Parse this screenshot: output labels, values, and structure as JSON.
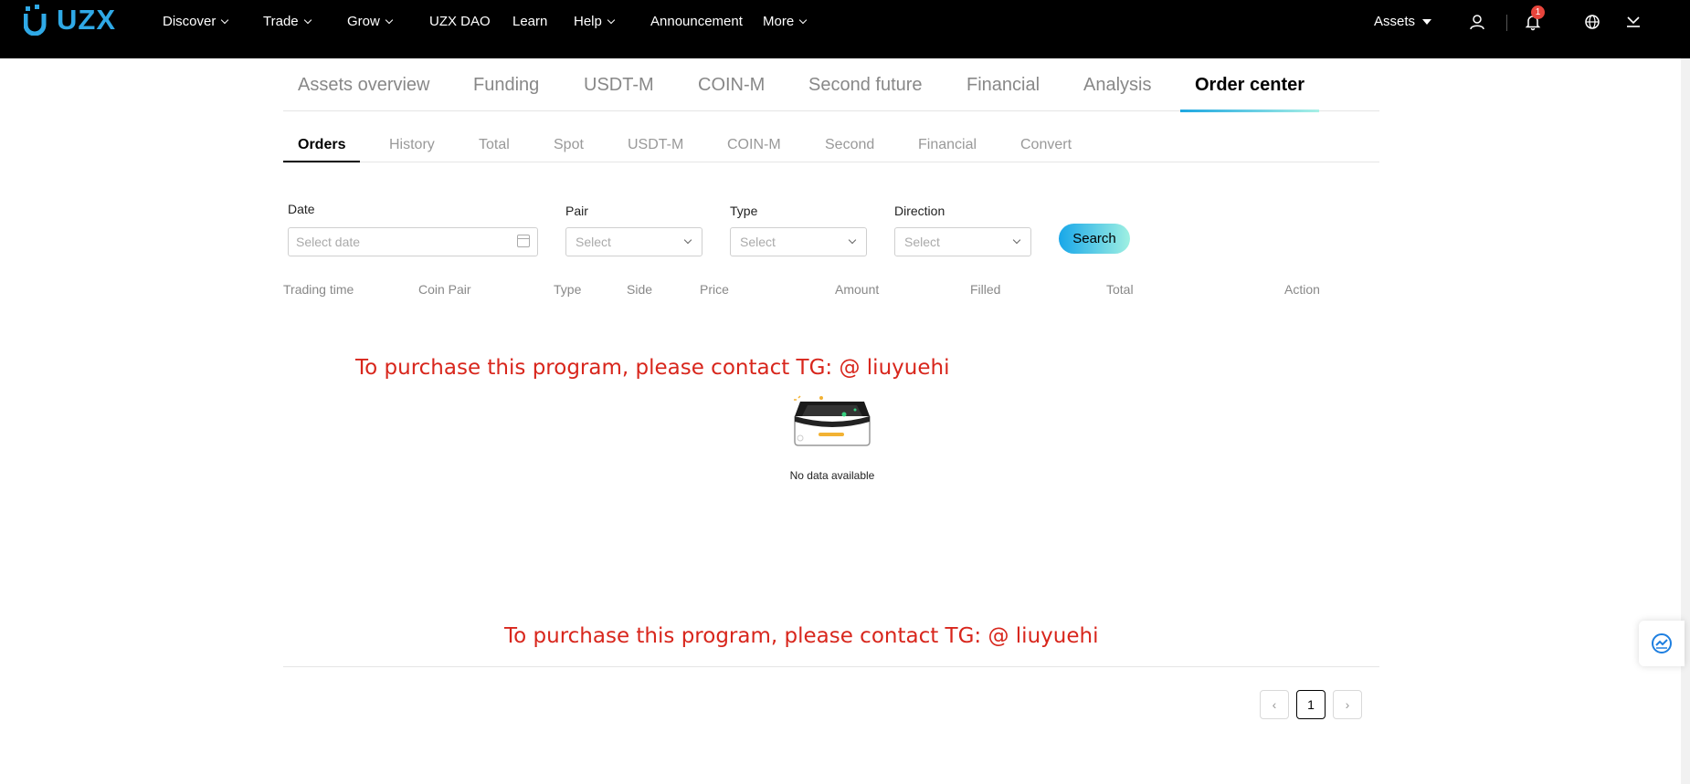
{
  "nav": {
    "logo": "UZX",
    "items": [
      {
        "label": "Discover"
      },
      {
        "label": "Trade"
      },
      {
        "label": "Grow"
      },
      {
        "label": "UZX DAO"
      },
      {
        "label": "Learn"
      },
      {
        "label": "Help"
      },
      {
        "label": "Announcement"
      },
      {
        "label": "More"
      }
    ],
    "assets": "Assets",
    "notification_count": "1",
    "icons": [
      "user-icon",
      "bell-icon",
      "globe-icon",
      "download-icon"
    ]
  },
  "main_tabs": [
    "Assets overview",
    "Funding",
    "USDT-M",
    "COIN-M",
    "Second future",
    "Financial",
    "Analysis",
    "Order center"
  ],
  "main_tab_active": "Order center",
  "sub_tabs": [
    "Orders",
    "History",
    "Total",
    "Spot",
    "USDT-M",
    "COIN-M",
    "Second",
    "Financial",
    "Convert"
  ],
  "sub_tab_active": "Orders",
  "filters": {
    "date_label": "Date",
    "date_placeholder": "Select date",
    "pair_label": "Pair",
    "pair_value": "Select",
    "type_label": "Type",
    "type_value": "Select",
    "direction_label": "Direction",
    "direction_value": "Select",
    "search_button": "Search"
  },
  "table_headers": [
    "Trading time",
    "Coin Pair",
    "Type",
    "Side",
    "Price",
    "Amount",
    "Filled",
    "Total",
    "Action"
  ],
  "empty_text": "No data available",
  "watermark_1": "To purchase this program, please contact TG: @ liuyuehi",
  "watermark_2": "To purchase this program, please contact TG: @ liuyuehi",
  "pagination": {
    "prev": "‹",
    "current": "1",
    "next": "›"
  },
  "colors": {
    "accent_start": "#18a7e9",
    "accent_end": "#9ff0e2",
    "badge": "#e8453c",
    "watermark": "#d8261c"
  }
}
